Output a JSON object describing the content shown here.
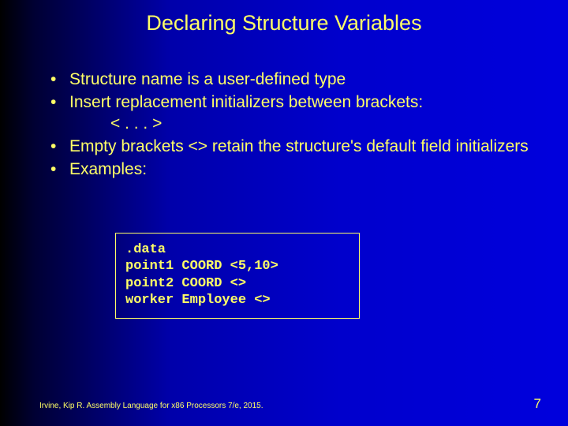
{
  "title": "Declaring Structure Variables",
  "bullets": [
    {
      "text": "Structure name is a user-defined type"
    },
    {
      "text": "Insert replacement initializers between brackets:",
      "sub": "< . . . >"
    },
    {
      "text": "Empty brackets <> retain the structure's default field initializers"
    },
    {
      "text": "Examples:"
    }
  ],
  "code": ".data\npoint1 COORD <5,10>\npoint2 COORD <>\nworker Employee <>",
  "footer": {
    "citation": "Irvine, Kip R. Assembly Language for x86 Processors 7/e, 2015.",
    "page": "7"
  }
}
